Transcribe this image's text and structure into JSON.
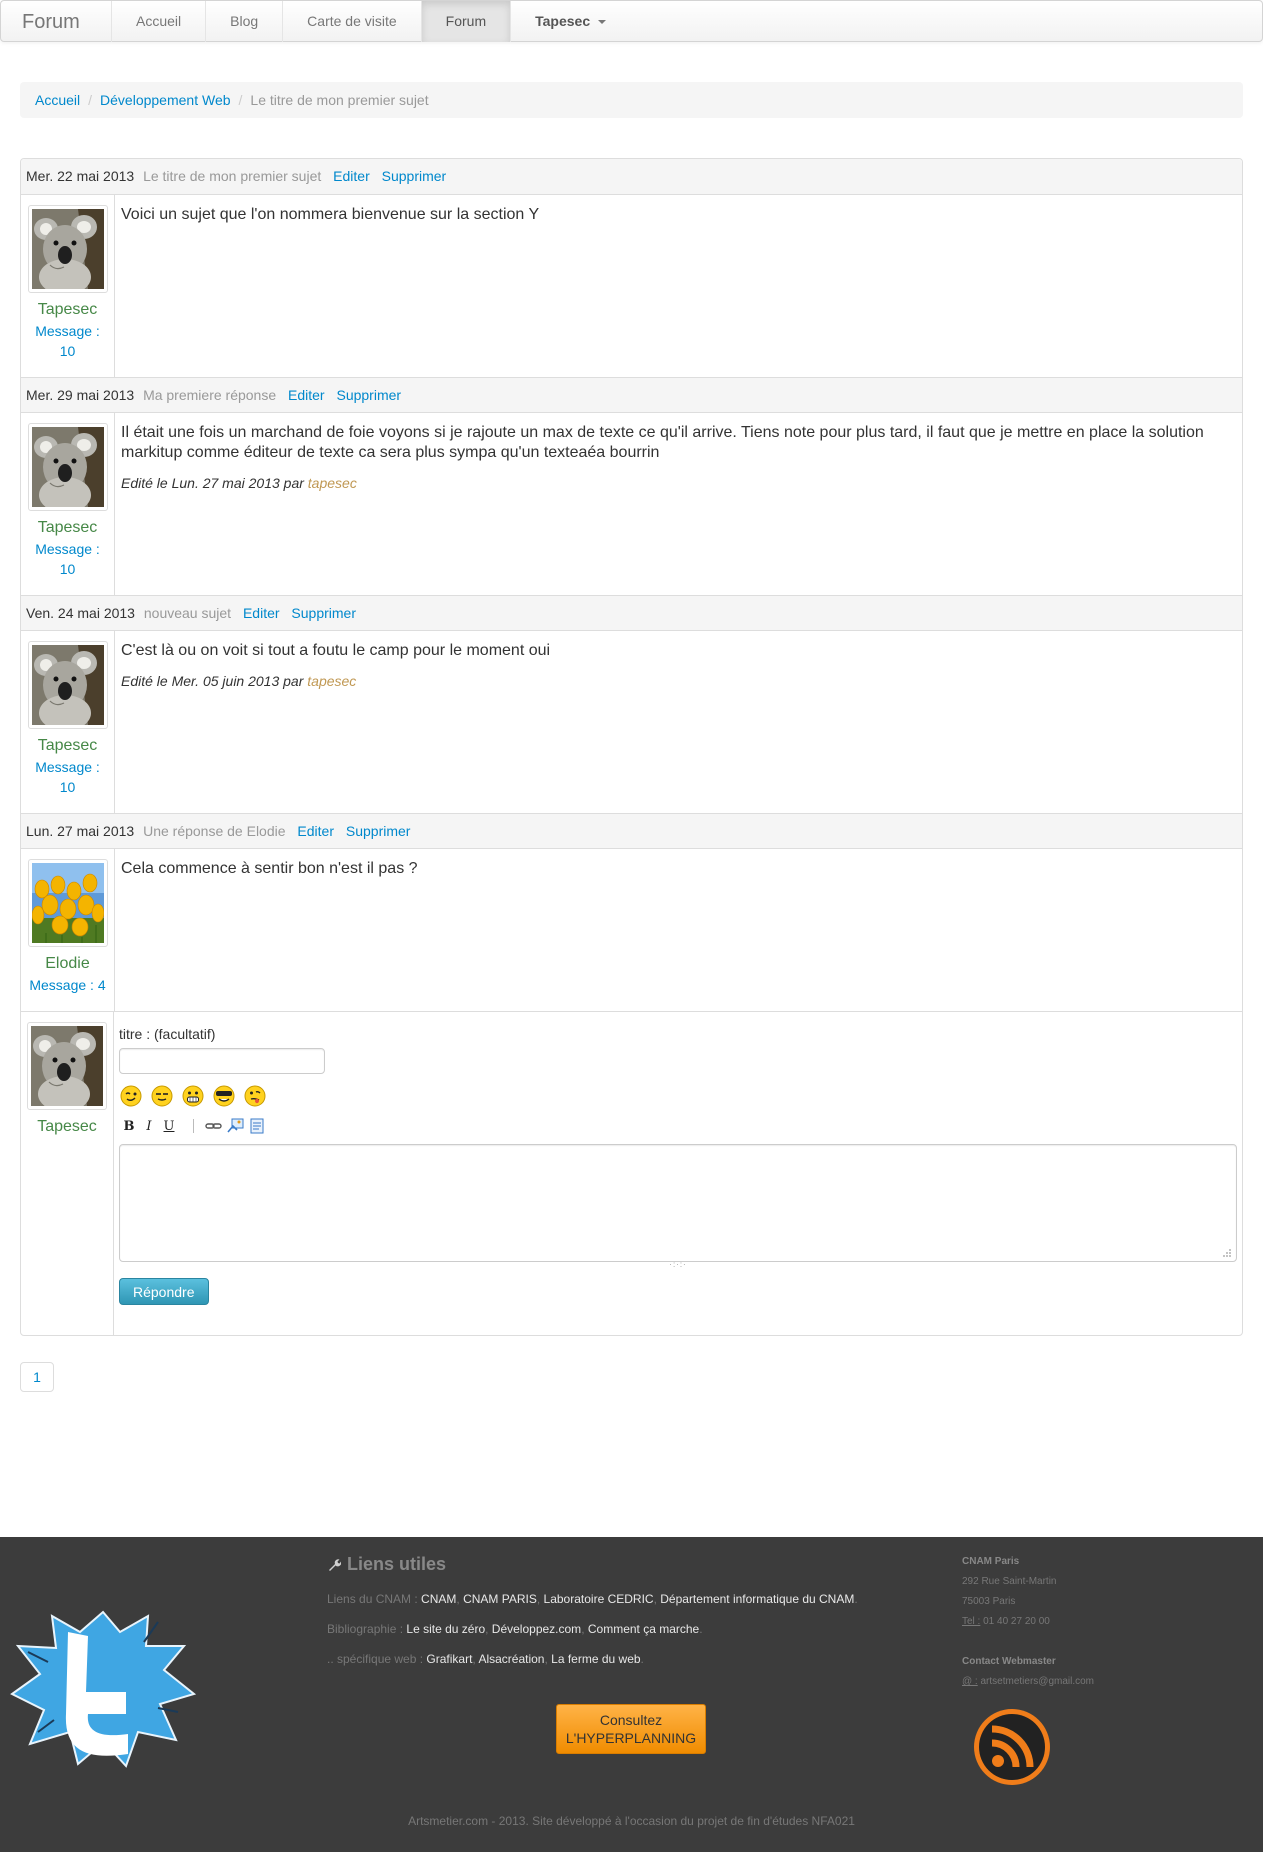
{
  "navbar": {
    "brand": "Forum",
    "items": [
      {
        "label": "Accueil",
        "active": false
      },
      {
        "label": "Blog",
        "active": false
      },
      {
        "label": "Carte de visite",
        "active": false
      },
      {
        "label": "Forum",
        "active": true
      }
    ],
    "user": "Tapesec"
  },
  "breadcrumb": {
    "home": "Accueil",
    "section": "Développement Web",
    "current": "Le titre de mon premier sujet",
    "separator": "/"
  },
  "posts": [
    {
      "date": "Mer. 22 mai 2013",
      "subject": "Le titre de mon premier sujet",
      "edit_label": "Editer",
      "delete_label": "Supprimer",
      "author": "Tapesec",
      "message_label": "Message :",
      "message_count": "10",
      "content": "Voici un sujet que l'on nommera bienvenue sur la section Y",
      "edit_note": null
    },
    {
      "date": "Mer. 29 mai 2013",
      "subject": "Ma premiere réponse",
      "edit_label": "Editer",
      "delete_label": "Supprimer",
      "author": "Tapesec",
      "message_label": "Message :",
      "message_count": "10",
      "content": "Il était une fois un marchand de foie voyons si je rajoute un max de texte ce qu'il arrive. Tiens note pour plus tard, il faut que je mettre en place la solution markitup comme éditeur de texte ca sera plus sympa qu'un texteaéa bourrin",
      "edit_note": {
        "prefix": "Edité le Lun. 27 mai 2013 par",
        "user": "tapesec"
      }
    },
    {
      "date": "Ven. 24 mai 2013",
      "subject": "nouveau sujet",
      "edit_label": "Editer",
      "delete_label": "Supprimer",
      "author": "Tapesec",
      "message_label": "Message :",
      "message_count": "10",
      "content": "C'est là ou on voit si tout a foutu le camp pour le moment oui",
      "edit_note": {
        "prefix": "Edité le Mer. 05 juin 2013 par",
        "user": "tapesec"
      }
    },
    {
      "date": "Lun. 27 mai 2013",
      "subject": "Une réponse de Elodie",
      "edit_label": "Editer",
      "delete_label": "Supprimer",
      "author": "Elodie",
      "message_label": "Message : 4",
      "message_count": "",
      "content": "Cela commence à sentir bon n'est il pas ?",
      "edit_note": null
    }
  ],
  "reply": {
    "author": "Tapesec",
    "title_label": "titre : (facultatif)",
    "title_value": "",
    "smileys": [
      "smiley-wink-icon",
      "smiley-neutral-icon",
      "smiley-grin-icon",
      "smiley-cool-icon",
      "smiley-tongue-icon"
    ],
    "toolbar": {
      "bold": "B",
      "italic": "I",
      "underline": "U"
    },
    "toolbar_icons": [
      "link-icon",
      "image-icon",
      "quote-icon"
    ],
    "message_value": "",
    "grip": "·:·:·",
    "submit_label": "Répondre"
  },
  "pagination": {
    "current": "1"
  },
  "footer": {
    "title": "Liens utiles",
    "link_groups": [
      {
        "label": "Liens du CNAM :",
        "links": [
          "CNAM",
          "CNAM PARIS",
          "Laboratoire CEDRIC",
          "Département informatique du CNAM"
        ]
      },
      {
        "label": "Bibliographie :",
        "links": [
          "Le site du zéro",
          "Développez.com",
          "Comment ça marche"
        ]
      },
      {
        "label": ".. spécifique web :",
        "links": [
          "Grafikart",
          "Alsacréation",
          "La ferme du web"
        ]
      }
    ],
    "hyperplanning_line1": "Consultez",
    "hyperplanning_line2": "L'HYPERPLANNING",
    "contact": {
      "org": "CNAM Paris",
      "street": "292 Rue Saint-Martin",
      "city": "75003 Paris",
      "tel_label": "Tel :",
      "tel": "01 40 27 20 00",
      "webmaster_title": "Contact Webmaster",
      "email_label": "@ :",
      "email": "artsetmetiers@gmail.com"
    },
    "copyright": "Artsmetier.com - 2013. Site développé à l'occasion du projet de fin d'études NFA021"
  },
  "colors": {
    "link": "#0088cc",
    "author": "#468847",
    "edit_user": "#c09853",
    "footer_bg": "#3c3c3c",
    "button_info": "#2f96b4",
    "hyperplanning": "#f08c00"
  }
}
